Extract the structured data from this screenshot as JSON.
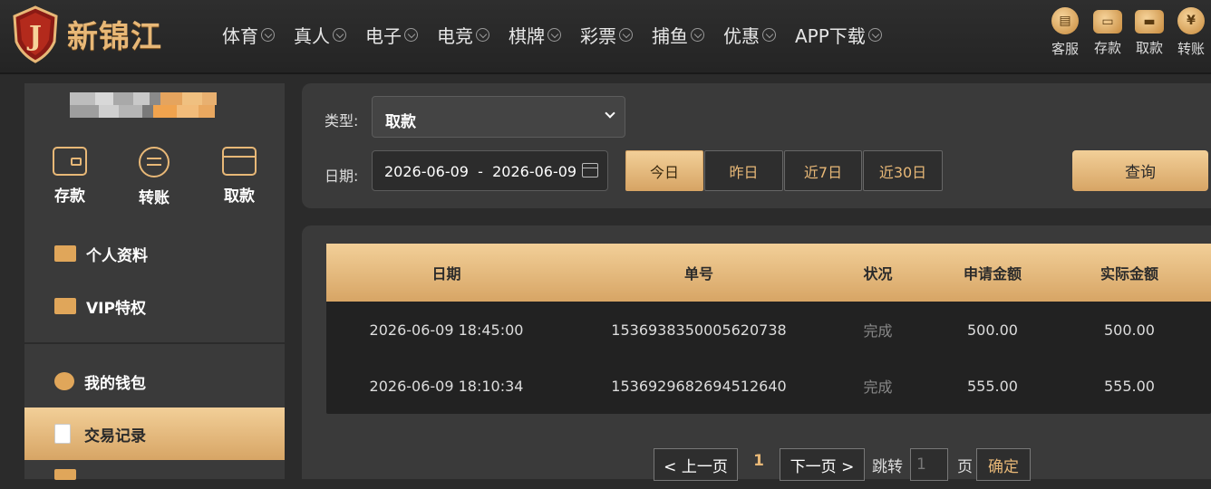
{
  "brand": {
    "name": "新锦江",
    "badge_letter": "J"
  },
  "nav": [
    "体育",
    "真人",
    "电子",
    "电竞",
    "棋牌",
    "彩票",
    "捕鱼",
    "优惠",
    "APP下载"
  ],
  "quick_actions": [
    {
      "label": "客服",
      "icon": "chat-icon"
    },
    {
      "label": "存款",
      "icon": "wallet-icon"
    },
    {
      "label": "取款",
      "icon": "briefcase-icon"
    },
    {
      "label": "转账",
      "icon": "coin-icon"
    }
  ],
  "sidebar": {
    "shortcuts": [
      {
        "label": "存款",
        "icon": "wallet-icon"
      },
      {
        "label": "转账",
        "icon": "transfer-icon"
      },
      {
        "label": "取款",
        "icon": "card-icon"
      }
    ],
    "menu": [
      {
        "label": "个人资料",
        "icon": "profile-icon"
      },
      {
        "label": "VIP特权",
        "icon": "vip-icon"
      },
      {
        "label": "我的钱包",
        "icon": "piggy-bank-icon"
      },
      {
        "label": "交易记录",
        "icon": "document-icon",
        "active": true
      }
    ]
  },
  "filter": {
    "type_label": "类型:",
    "type_value": "取款",
    "date_label": "日期:",
    "date_range": "2026-06-09  -  2026-06-09",
    "quick_ranges": [
      "今日",
      "昨日",
      "近7日",
      "近30日"
    ],
    "active_range": "今日",
    "query_label": "查询"
  },
  "table": {
    "headers": [
      "日期",
      "单号",
      "状况",
      "申请金额",
      "实际金额"
    ],
    "rows": [
      [
        "2026-06-09 18:45:00",
        "1536938350005620738",
        "完成",
        "500.00",
        "500.00"
      ],
      [
        "2026-06-09 18:10:34",
        "1536929682694512640",
        "完成",
        "555.00",
        "555.00"
      ]
    ]
  },
  "pager": {
    "prev": "< 上一页",
    "current": "1",
    "next": "下一页 >",
    "jump_label": "跳转",
    "page_input_placeholder": "1",
    "page_suffix": "页",
    "confirm": "确定"
  },
  "colors": {
    "accent": "#e8b877",
    "accent_dark": "#d7a565",
    "bg": "#2b2b2b",
    "panel": "#3a3a3a"
  }
}
